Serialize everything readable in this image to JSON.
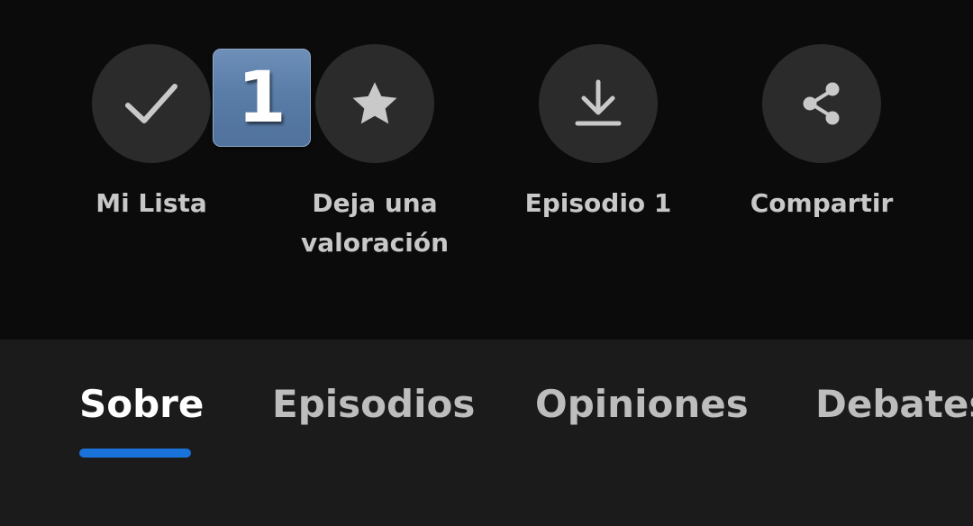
{
  "actions": [
    {
      "label": "Mi Lista",
      "icon": "check-icon"
    },
    {
      "label": "Deja una valoración",
      "icon": "star-icon"
    },
    {
      "label": "Episodio 1",
      "icon": "download-icon"
    },
    {
      "label": "Compartir",
      "icon": "share-icon"
    }
  ],
  "badge": {
    "text": "1"
  },
  "tabs": [
    {
      "label": "Sobre",
      "active": true
    },
    {
      "label": "Episodios",
      "active": false
    },
    {
      "label": "Opiniones",
      "active": false
    },
    {
      "label": "Debates",
      "active": false
    }
  ],
  "colors": {
    "accent": "#1a73d9",
    "background": "#0b0b0b",
    "tab_bar": "#1b1b1b",
    "button_circle": "#2b2b2b",
    "label": "#c8c8c8"
  }
}
